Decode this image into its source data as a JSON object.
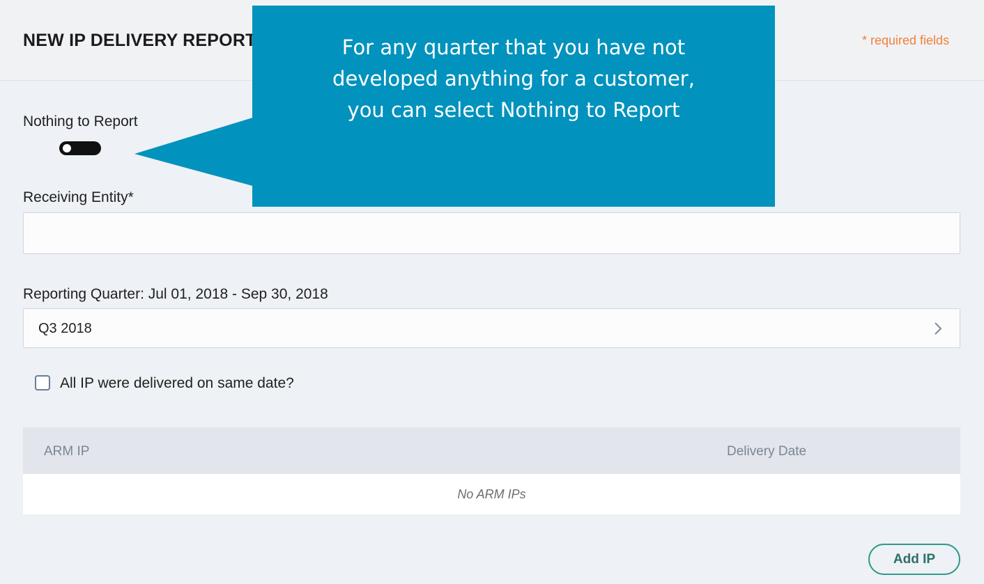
{
  "header": {
    "title": "NEW IP DELIVERY REPORT",
    "required_note": "* required fields"
  },
  "form": {
    "nothing_to_report": {
      "label": "Nothing to Report",
      "enabled": true
    },
    "receiving_entity": {
      "label": "Receiving Entity*",
      "value": "",
      "placeholder": ""
    },
    "reporting_quarter": {
      "label": "Reporting Quarter: Jul 01, 2018 - Sep 30, 2018",
      "selected": "Q3 2018",
      "chevron_icon": "chevron-right-icon"
    },
    "same_date_checkbox": {
      "label": "All IP were delivered on same date?",
      "checked": false
    }
  },
  "ip_table": {
    "columns": [
      "ARM IP",
      "Delivery Date"
    ],
    "rows": [],
    "empty_message": "No ARM IPs"
  },
  "actions": {
    "add_ip_label": "Add IP"
  },
  "callout": {
    "lines": [
      "For any quarter that you have not",
      "developed anything for a customer,",
      "you can select Nothing to Report"
    ]
  },
  "colors": {
    "accent_teal": "#2f9a8c",
    "required_orange": "#f0813a",
    "callout_blue": "#0192bd",
    "page_bg": "#eef1f5"
  }
}
